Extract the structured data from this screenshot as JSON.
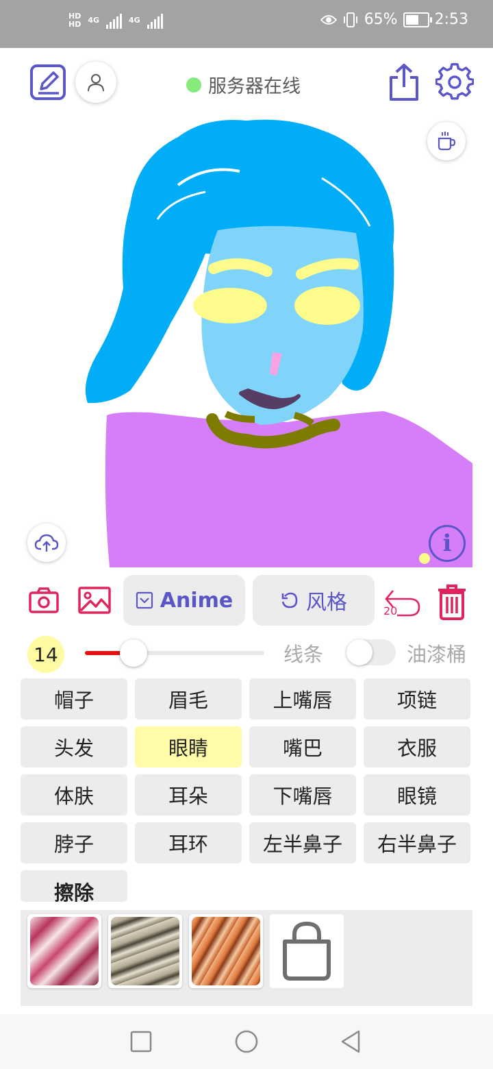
{
  "status_bar": {
    "hd_top": "HD",
    "hd_bottom": "HD",
    "net1": "4G",
    "net2": "4G",
    "battery_percent": "65%",
    "battery_level": 0.65,
    "time": "2:53"
  },
  "header": {
    "server_status": "服务器在线",
    "server_color": "#86ea7c"
  },
  "canvas": {
    "info_symbol": "i"
  },
  "toolbar": {
    "mode_label": "Anime",
    "style_label": "风格",
    "undo_count": "20"
  },
  "brush": {
    "size": "14",
    "slider_level": 0.27,
    "line_label": "线条",
    "bucket_label": "油漆桶",
    "bucket_enabled": false
  },
  "parts": [
    {
      "label": "帽子",
      "selected": false
    },
    {
      "label": "眉毛",
      "selected": false
    },
    {
      "label": "上嘴唇",
      "selected": false
    },
    {
      "label": "项链",
      "selected": false
    },
    {
      "label": "头发",
      "selected": false
    },
    {
      "label": "眼睛",
      "selected": true
    },
    {
      "label": "嘴巴",
      "selected": false
    },
    {
      "label": "衣服",
      "selected": false
    },
    {
      "label": "体肤",
      "selected": false
    },
    {
      "label": "耳朵",
      "selected": false
    },
    {
      "label": "下嘴唇",
      "selected": false
    },
    {
      "label": "眼镜",
      "selected": false
    },
    {
      "label": "脖子",
      "selected": false
    },
    {
      "label": "耳环",
      "selected": false
    },
    {
      "label": "左半鼻子",
      "selected": false
    },
    {
      "label": "右半鼻子",
      "selected": false
    }
  ],
  "erase_label": "擦除",
  "colors": {
    "accent": "#5a56c8",
    "danger": "#e0245e",
    "hair": "#00adf6",
    "skin": "#80d4fa",
    "brows_eyes": "#fdfb8c",
    "shirt": "#d67ef7",
    "necklace": "#7d7b00",
    "mouth": "#563d63",
    "nose": "#f9a3e7"
  },
  "icons": {
    "draw": "edit-pencil-icon",
    "user": "user-icon",
    "share": "share-icon",
    "settings": "gear-icon",
    "coffee": "coffee-cup-icon",
    "upload": "cloud-upload-icon",
    "camera": "camera-icon",
    "image": "image-icon",
    "undo": "undo-icon",
    "delete": "trash-icon",
    "store": "shopping-bag-icon"
  }
}
